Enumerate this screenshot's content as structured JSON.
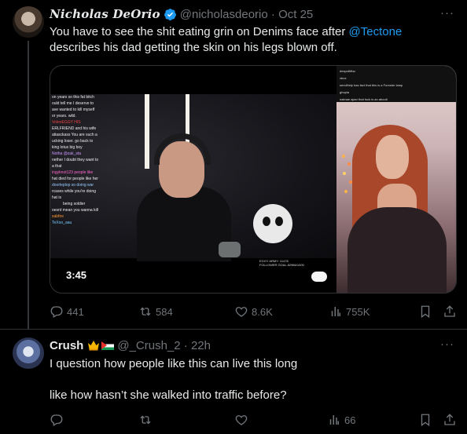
{
  "tweets": [
    {
      "author_name": "Nicholas DeOrio",
      "handle": "@nicholasdeorio",
      "date": "Oct 25",
      "verified": true,
      "text_before": "You have to see the shit eating grin on Denims face after ",
      "mention": "@Tectone",
      "text_after": "describes his dad getting the skin on his legs blown off.",
      "media": {
        "duration": "3:45",
        "chat_lines": [
          "on years so this fat bitch",
          "ould tell me I deserve to",
          "ave wanted to kill myself",
          "or years. wild.",
          "VolenEGGY  HIS",
          "ERLFRIEND and his wife",
          "",
          "atiasckass  You are such a",
          "ucking loser. go back to",
          "king lotus big boy",
          "Notha  @zak_sta",
          "nether I doubt they want to",
          "a that",
          "ingyknot123  people like",
          "hat died for people like her",
          "doorleplop  so doing war",
          "rcases while you're doing",
          "hat is",
          "being soldier",
          "oesnt mean you wanna kill",
          "sabfire",
          "TeXoo_aau"
        ],
        "overlay_text": "EGGY ARMY: 11478  FOLLOWER GOAL 82966/1000",
        "side_chat_lines": [
          "despotMisc",
          "xbox",
          "sendHelp has fact that this is a Forester lamp",
          "ghopia",
          "naimae ajaxr that fuck is an abouti"
        ]
      },
      "stats": {
        "replies": "441",
        "reposts": "584",
        "likes": "8.6K",
        "views": "755K"
      }
    },
    {
      "author_name": "Crush",
      "handle": "@_Crush_2",
      "date": "22h",
      "text_line1": "I question how people like this can live this long",
      "text_line2": "like how hasn’t she walked into traffic before?",
      "stats": {
        "replies": "",
        "reposts": "",
        "likes": "",
        "views": "66"
      }
    }
  ],
  "colors": {
    "accent": "#1d9bf0",
    "muted": "#71767b",
    "background": "#000000",
    "text": "#e7e9ea",
    "divider": "#2f3336"
  },
  "icons": [
    "verified-badge-icon",
    "more-icon",
    "reply-icon",
    "repost-icon",
    "like-icon",
    "views-icon",
    "bookmark-icon",
    "share-icon",
    "crown-emoji-icon",
    "palestine-flag-icon"
  ]
}
